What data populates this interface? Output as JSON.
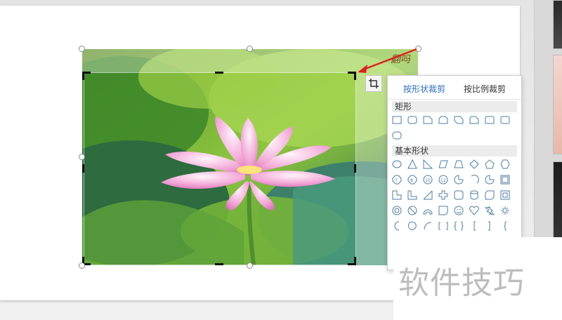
{
  "menu": {
    "tabs": [
      {
        "label": "按形状裁剪",
        "active": true
      },
      {
        "label": "按比例裁剪",
        "active": false
      }
    ],
    "sections": [
      {
        "title": "矩形"
      },
      {
        "title": "基本形状"
      }
    ]
  },
  "watermark": {
    "text": "软件技巧"
  },
  "logo": {
    "text": "翻吗"
  },
  "colors": {
    "accent_tab": "#2c6fbf",
    "arrow": "#e02020",
    "shape_stroke": "#4f7ea0"
  },
  "icons": {
    "crop_button": "crop-icon"
  }
}
